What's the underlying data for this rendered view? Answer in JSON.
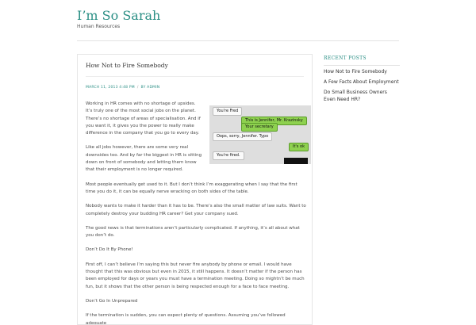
{
  "site": {
    "title": "I’m So Sarah",
    "description": "Human Resources"
  },
  "post": {
    "title": "How Not to Fire Somebody",
    "date": "MARCH 11, 2013 4:48 PM",
    "separator": "/",
    "author": "BY ADMIN",
    "paragraphs": [
      "Working in HR comes with no shortage of upsides. It’s truly one of the most social jobs on the planet. There’s no shortage of areas of specialisation. And if you want it, it gives you the power to really make difference in the company that you go to every day.",
      "Like all jobs however, there are some very real downsides too. And by far the biggest in HR is sitting down on front of somebody and letting them know that their employment is no longer required.",
      "Most people eventually get used to it. But I don’t think I’m exaggerating when I say that the first time you do it, it can be equally nerve wracking on both sides of the table.",
      "Nobody wants to make it harder than it has to be. There’s also the small matter of law suits. Want to completely destroy your budding HR career? Get your company sued.",
      "The good news is that terminations aren’t particularly complicated. If anything, it’s all about what you don’t do.",
      "Don’t Do It By Phone!",
      "First off, I can’t believe I’m saying this but never fire anybody by phone or email. I would have thought that this was obvious but even in 2015, it still happens. It doesn’t matter if the person has been employed for days or years you must have a termination meeting. Doing so mightn’t be much fun, but it shows that the other person is being respected enough for a face to face meeting.",
      "Don’t Go In Unprepared",
      "If the termination is sudden, you can expect plenty of questions. Assuming you’ve followed adequate"
    ],
    "image_messages": [
      "You're Fred",
      "This is Jennifer, Mr. Krazinsky",
      "Your secretary",
      "Oops, sorry, Jennifer. Typo",
      "It's ok",
      "You're fired."
    ]
  },
  "sidebar": {
    "recent_posts_title": "RECENT POSTS",
    "recent_posts": [
      "How Not to Fire Somebody",
      "A Few Facts About Employment",
      "Do Small Business Owners Even Need HR?"
    ]
  }
}
